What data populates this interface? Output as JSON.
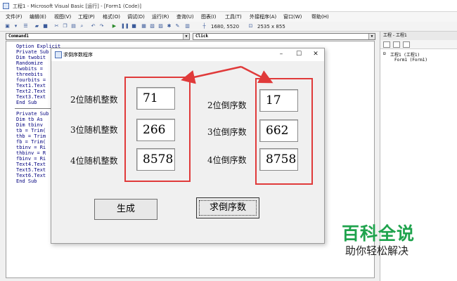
{
  "window": {
    "title": "工程1 - Microsoft Visual Basic [运行] - [Form1 (Code)]"
  },
  "menu": [
    "文件(F)",
    "编辑(E)",
    "视图(V)",
    "工程(P)",
    "格式(O)",
    "调试(D)",
    "运行(R)",
    "查询(U)",
    "图表(I)",
    "工具(T)",
    "外接程序(A)",
    "窗口(W)",
    "帮助(H)"
  ],
  "toolbar": {
    "position": "1680, 5520",
    "size": "2535 x 855"
  },
  "code_editor": {
    "object_combo": "Command1",
    "proc_combo": "Click",
    "lines": [
      "Option Explicit",
      "Private Sub",
      "  Dim twobit",
      "  Randomize",
      "  twobits =",
      "  threebits",
      "  fourbits =",
      "  Text1.Text",
      "  Text2.Text",
      "  Text3.Text",
      "End Sub",
      "",
      "Private Sub",
      "  Dim tb As",
      "  Dim tbinv",
      "  tb = Trim(",
      "  thb = Trim",
      "  fb = Trim(",
      "  tbinv = Ri",
      "  thbinv = R",
      "  fbinv = Ri",
      "  Text4.Text",
      "  Text5.Text",
      "  Text6.Text",
      "End Sub"
    ]
  },
  "project_panel": {
    "title": "工程 - 工程1",
    "tree": [
      "工程1 (工程1)",
      "Form1 (Form1)"
    ]
  },
  "dialog": {
    "title": "求倒序数程序",
    "left_labels": [
      "2位随机整数",
      "3位随机整数",
      "4位随机整数"
    ],
    "left_values": [
      "71",
      "266",
      "8578"
    ],
    "right_labels": [
      "2位倒序数",
      "3位倒序数",
      "4位倒序数"
    ],
    "right_values": [
      "17",
      "662",
      "8758"
    ],
    "generate_button": "生成",
    "reverse_button": "求倒序数"
  },
  "watermark": {
    "brand": "百科全说",
    "slogan": "助你轻松解决"
  },
  "colors": {
    "annotation": "#e03a3a",
    "watermark_green": "#1fa34d",
    "code_blue": "#00007f"
  }
}
